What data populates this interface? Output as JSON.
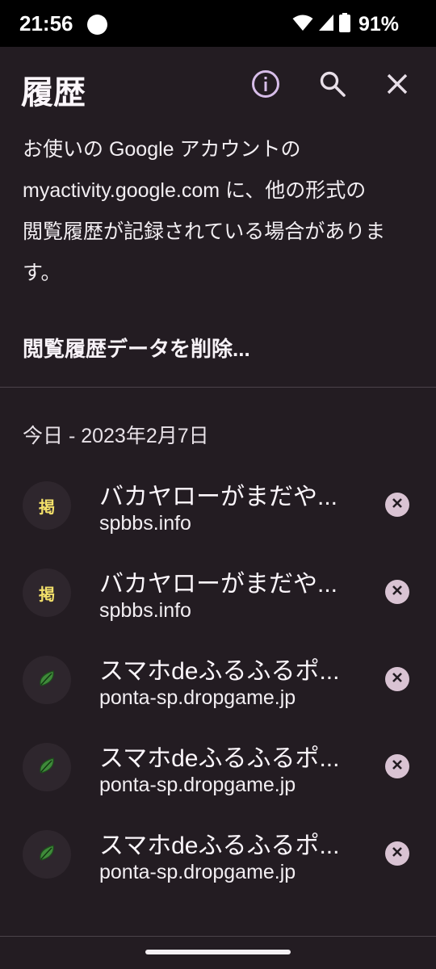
{
  "status_bar": {
    "time": "21:56",
    "battery": "91%",
    "icons": [
      "notification-dot-icon",
      "wifi-icon",
      "signal-icon",
      "battery-icon"
    ]
  },
  "header": {
    "title": "履歴",
    "actions": [
      "info-icon",
      "search-icon",
      "close-icon"
    ]
  },
  "info": {
    "line1": "お使いの Google アカウントの",
    "line2": "myactivity.google.com に、他の形式の",
    "line3": "閲覧履歴が記録されている場合がありま",
    "line4": "す。"
  },
  "clear_data_label": "閲覧履歴データを削除...",
  "date_header": "今日 - 2023年2月7日",
  "favicon_glyph": "掲",
  "items": [
    {
      "title": "バカヤローがまだや...",
      "url": "spbbs.info",
      "favicon": "kanji-favicon-icon"
    },
    {
      "title": "バカヤローがまだや...",
      "url": "spbbs.info",
      "favicon": "kanji-favicon-icon"
    },
    {
      "title": "スマホdeふるふるポ...",
      "url": "ponta-sp.dropgame.jp",
      "favicon": "leaf-icon"
    },
    {
      "title": "スマホdeふるふるポ...",
      "url": "ponta-sp.dropgame.jp",
      "favicon": "leaf-icon"
    },
    {
      "title": "スマホdeふるふるポ...",
      "url": "ponta-sp.dropgame.jp",
      "favicon": "leaf-icon"
    }
  ],
  "colors": {
    "background": "#231c22",
    "accent": "#d7bde9",
    "remove_button": "#d9c3d3",
    "leaf": "#3f8a3a",
    "kanji_favicon": "#f3e06a"
  }
}
